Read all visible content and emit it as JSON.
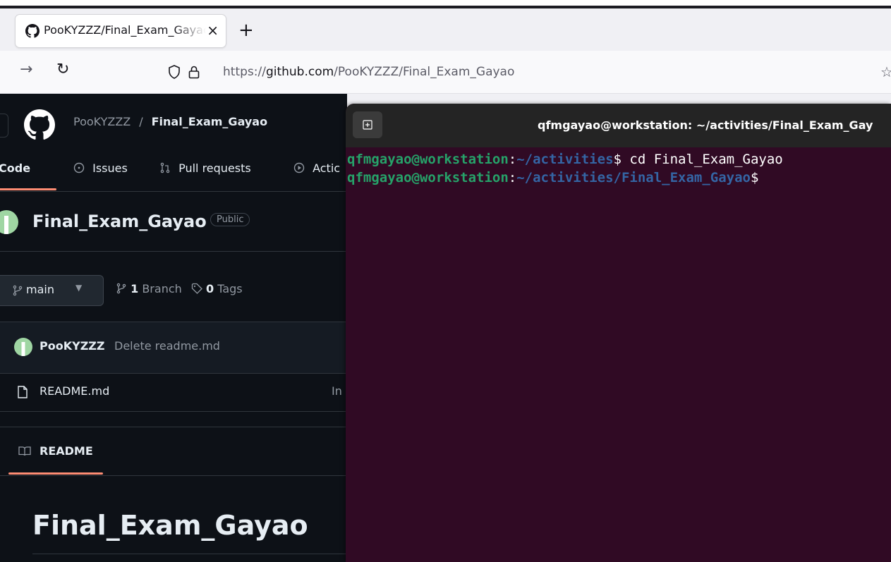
{
  "browser": {
    "tab_title": "PooKYZZZ/Final_Exam_Gayao",
    "url_prefix": "https://",
    "url_host": "github.com",
    "url_path": "/PooKYZZZ/Final_Exam_Gayao"
  },
  "github": {
    "owner": "PooKYZZZ",
    "separator": "/",
    "repo": "Final_Exam_Gayao",
    "tabs": [
      {
        "label": "Code"
      },
      {
        "label": "Issues"
      },
      {
        "label": "Pull requests"
      },
      {
        "label": "Actic"
      }
    ],
    "repo_name": "Final_Exam_Gayao",
    "visibility": "Public",
    "branch": "main",
    "branch_count": "1",
    "branch_label": "Branch",
    "tag_count": "0",
    "tag_label": "Tags",
    "commit_user": "PooKYZZZ",
    "commit_message": "Delete readme.md",
    "file_name": "README.md",
    "file_trunc": "In",
    "readme_tab": "README",
    "readme_heading": "Final_Exam_Gayao"
  },
  "terminal": {
    "title": "qfmgayao@workstation: ~/activities/Final_Exam_Gay",
    "lines": [
      {
        "user": "qfmgayao@workstation",
        "colon": ":",
        "path": "~/activities",
        "prompt": "$",
        "cmd": " cd Final_Exam_Gayao"
      },
      {
        "user": "qfmgayao@workstation",
        "colon": ":",
        "path": "~/activities/Final_Exam_Gayao",
        "prompt": "$",
        "cmd": ""
      }
    ]
  },
  "colors": {
    "terminal_bg": "#300a24",
    "github_bg": "#0d1117",
    "accent_underline": "#fd8c73"
  }
}
